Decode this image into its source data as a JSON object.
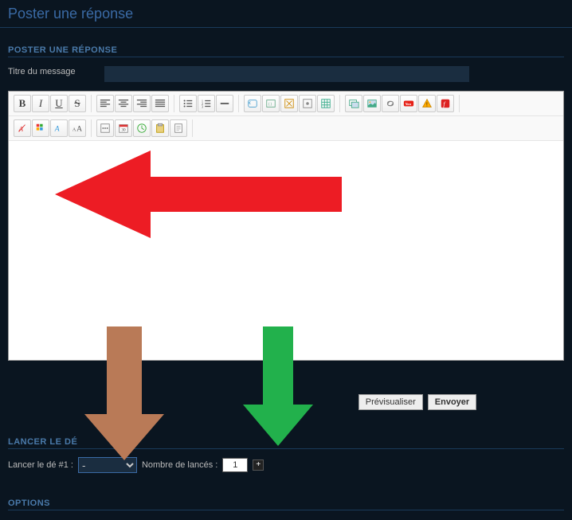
{
  "page": {
    "title": "Poster une réponse"
  },
  "sections": {
    "reply_header": "POSTER UNE RÉPONSE",
    "dice_header": "LANCER LE DÉ",
    "options_header": "OPTIONS"
  },
  "title_field": {
    "label": "Titre du message",
    "value": ""
  },
  "toolbar": {
    "row1": [
      [
        "bold",
        "italic",
        "underline",
        "strike"
      ],
      [
        "align-left",
        "align-center",
        "align-right",
        "align-justify"
      ],
      [
        "list-unordered",
        "list-ordered",
        "horizontal-rule"
      ],
      [
        "quote",
        "code",
        "spoiler",
        "hidden",
        "table"
      ],
      [
        "host-image",
        "image",
        "link",
        "youtube",
        "warning",
        "flash"
      ]
    ],
    "row2": [
      [
        "remove-format",
        "font-color",
        "font",
        "font-size"
      ],
      [
        "more",
        "date",
        "time",
        "paste",
        "page"
      ]
    ]
  },
  "buttons": {
    "preview": "Prévisualiser",
    "submit": "Envoyer"
  },
  "dice": {
    "label1": "Lancer le dé #1 :",
    "select_value": "-",
    "label2": "Nombre de lancés :",
    "count_value": "1"
  }
}
